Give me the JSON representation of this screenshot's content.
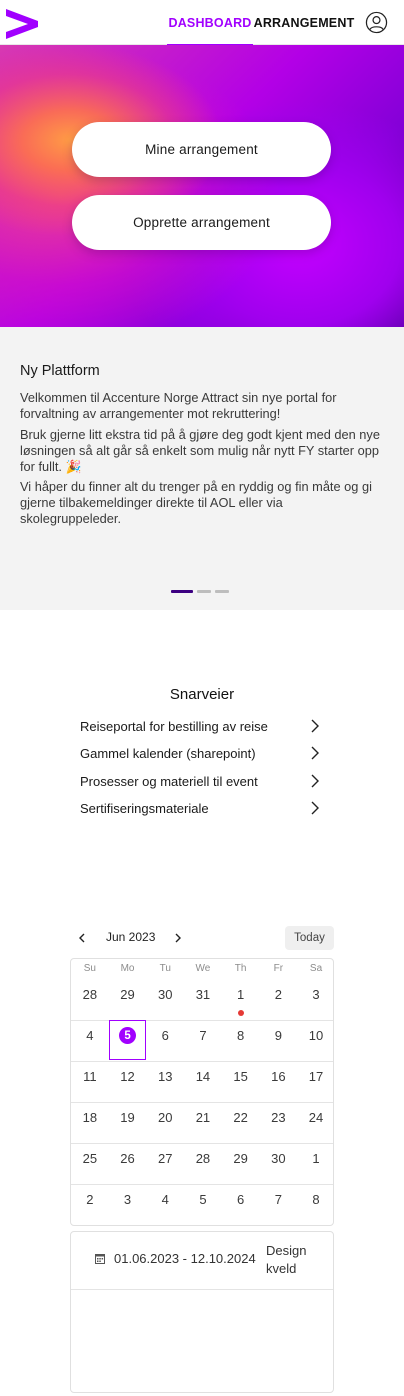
{
  "header": {
    "nav": [
      {
        "label": "DASHBOARD",
        "active": true
      },
      {
        "label": "ARRANGEMENT",
        "active": false
      }
    ],
    "logo_icon": "accenture-chevron-logo",
    "user_icon": "user-circle-icon",
    "accent_color": "#a100ff"
  },
  "hero": {
    "buttons": [
      "Mine arrangement",
      "Opprette arrangement"
    ]
  },
  "info": {
    "title": "Ny Plattform",
    "paragraphs": [
      "Velkommen til Accenture Norge Attract sin nye portal for forvaltning av arrangementer mot rekruttering!",
      "Bruk gjerne litt ekstra tid på å gjøre deg godt kjent med den nye løsningen så alt går så enkelt som mulig når nytt FY starter opp for fullt. 🎉",
      "Vi håper du finner alt du trenger på en ryddig og fin måte og gi gjerne tilbakemeldinger direkte til AOL eller via skolegruppeleder."
    ],
    "carousel_active_index": 0,
    "carousel_count": 3
  },
  "shortcuts": {
    "title": "Snarveier",
    "items": [
      "Reiseportal for bestilling av reise",
      "Gammel kalender (sharepoint)",
      "Prosesser og materiell til event",
      "Sertifiseringsmateriale"
    ]
  },
  "calendar": {
    "month": "Jun 2023",
    "today_label": "Today",
    "weekdays": [
      "Su",
      "Mo",
      "Tu",
      "We",
      "Th",
      "Fr",
      "Sa"
    ],
    "weeks": [
      [
        "28",
        "29",
        "30",
        "31",
        "1",
        "2",
        "3"
      ],
      [
        "4",
        "5",
        "6",
        "7",
        "8",
        "9",
        "10"
      ],
      [
        "11",
        "12",
        "13",
        "14",
        "15",
        "16",
        "17"
      ],
      [
        "18",
        "19",
        "20",
        "21",
        "22",
        "23",
        "24"
      ],
      [
        "25",
        "26",
        "27",
        "28",
        "29",
        "30",
        "1"
      ],
      [
        "2",
        "3",
        "4",
        "5",
        "6",
        "7",
        "8"
      ]
    ],
    "selected_day": "5",
    "event_dot_day": "1"
  },
  "events": [
    {
      "date_range": "01.06.2023 - 12.10.2024",
      "name": "Design kveld"
    }
  ]
}
